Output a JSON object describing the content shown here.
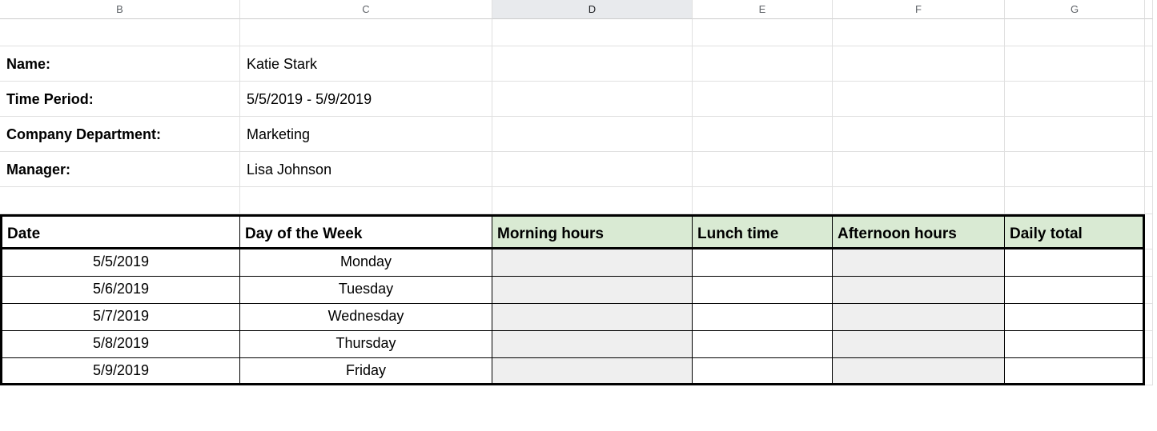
{
  "columns": {
    "b": "B",
    "c": "C",
    "d": "D",
    "e": "E",
    "f": "F",
    "g": "G"
  },
  "info": {
    "name_label": "Name:",
    "name_value": "Katie Stark",
    "period_label": "Time Period:",
    "period_value": "5/5/2019 - 5/9/2019",
    "dept_label": "Company Department:",
    "dept_value": "Marketing",
    "manager_label": "Manager:",
    "manager_value": "Lisa Johnson"
  },
  "table": {
    "headers": {
      "date": "Date",
      "dow": "Day of the Week",
      "morning": "Morning hours",
      "lunch": "Lunch time",
      "afternoon": "Afternoon hours",
      "total": "Daily total"
    },
    "rows": [
      {
        "date": "5/5/2019",
        "dow": "Monday",
        "morning": "",
        "lunch": "",
        "afternoon": "",
        "total": ""
      },
      {
        "date": "5/6/2019",
        "dow": "Tuesday",
        "morning": "",
        "lunch": "",
        "afternoon": "",
        "total": ""
      },
      {
        "date": "5/7/2019",
        "dow": "Wednesday",
        "morning": "",
        "lunch": "",
        "afternoon": "",
        "total": ""
      },
      {
        "date": "5/8/2019",
        "dow": "Thursday",
        "morning": "",
        "lunch": "",
        "afternoon": "",
        "total": ""
      },
      {
        "date": "5/9/2019",
        "dow": "Friday",
        "morning": "",
        "lunch": "",
        "afternoon": "",
        "total": ""
      }
    ]
  }
}
